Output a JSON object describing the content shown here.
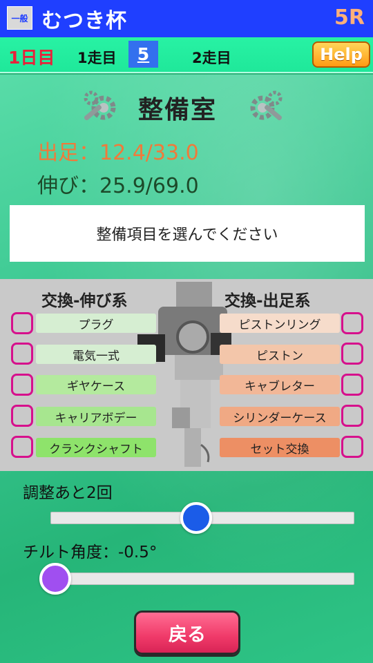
{
  "header": {
    "grade_badge": "一般",
    "race_title": "むつき杯",
    "race_number": "5R"
  },
  "daybar": {
    "day": "1日目",
    "run1_label": "1走目",
    "run1_value": "5",
    "run2_label": "2走目",
    "help_label": "Help"
  },
  "maintenance": {
    "title": "整備室",
    "start_stat": "出足：12.4/33.0",
    "stretch_stat": "伸び：25.9/69.0",
    "message": "整備項目を選んでください"
  },
  "parts": {
    "left_heading": "交換-伸び系",
    "right_heading": "交換-出足系",
    "left": [
      {
        "label": "プラグ",
        "color": "#d6eed2"
      },
      {
        "label": "電気一式",
        "color": "#d6eed2"
      },
      {
        "label": "ギヤケース",
        "color": "#b4ea9e"
      },
      {
        "label": "キャリアボデー",
        "color": "#a7e68f"
      },
      {
        "label": "クランクシャフト",
        "color": "#8ee36b"
      }
    ],
    "right": [
      {
        "label": "ピストンリング",
        "color": "#f6dccb"
      },
      {
        "label": "ピストン",
        "color": "#f3c6aa"
      },
      {
        "label": "キャブレター",
        "color": "#f2b797"
      },
      {
        "label": "シリンダーケース",
        "color": "#f0a984"
      },
      {
        "label": "セット交換",
        "color": "#ed8f64"
      }
    ]
  },
  "adjust": {
    "label": "調整あと2回",
    "slider_level": 0.48,
    "knob_color": "#1b5ce8"
  },
  "tilt": {
    "label": "チルト角度：-0.5°",
    "slider_level": 0.0,
    "knob_color": "#a04ff0"
  },
  "back_label": "戻る"
}
